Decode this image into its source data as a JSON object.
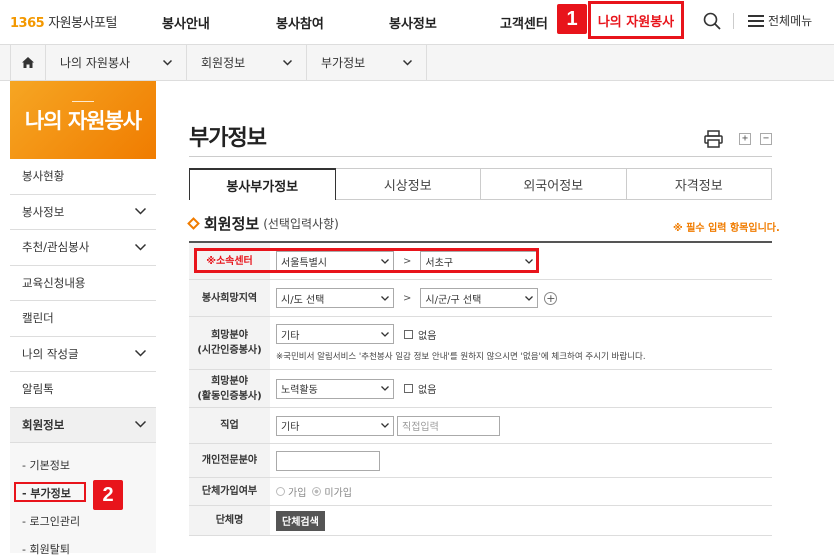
{
  "logo": {
    "num": "1365",
    "text": "자원봉사포털"
  },
  "nav": {
    "items": [
      "봉사안내",
      "봉사참여",
      "봉사정보",
      "고객센터"
    ],
    "active": "나의 자원봉사",
    "menu_label": "전체메뉴",
    "badge1": "1"
  },
  "breadcrumb": {
    "items": [
      "나의 자원봉사",
      "회원정보",
      "부가정보"
    ]
  },
  "sidebar": {
    "title": "나의 자원봉사",
    "items": [
      "봉사현황",
      "봉사정보",
      "추천/관심봉사",
      "교육신청내용",
      "캘린더",
      "나의 작성글",
      "알림톡",
      "회원정보"
    ],
    "sub_items": [
      "- 기본정보",
      "- 부가정보",
      "- 로그인관리",
      "- 회원탈퇴"
    ],
    "badge2": "2"
  },
  "main": {
    "page_title": "부가정보",
    "tabs": [
      "봉사부가정보",
      "시상정보",
      "외국어정보",
      "자격정보"
    ],
    "section_title": "회원정보",
    "section_sub": "(선택입력사항)",
    "required_note": "※ 필수 입력 항목입니다."
  },
  "form": {
    "center_label": "※소속센터",
    "center_sido": "서울특별시",
    "center_gu": "서초구",
    "gt": ">",
    "region_label": "봉사희망지역",
    "region_sido": "시/도 선택",
    "region_gu": "시/군/구 선택",
    "field1_label1": "희망분야",
    "field1_label2": "(시간인증봉사)",
    "field1_value": "기타",
    "none_label": "없음",
    "field1_note": "※국민비서 알림서비스 '추천봉사 일감 정보 안내'를 원하지 않으시면 '없음'에 체크하여 주시기 바랍니다.",
    "field2_label1": "희망분야",
    "field2_label2": "(활동인증봉사)",
    "field2_value": "노력활동",
    "job_label": "직업",
    "job_value": "기타",
    "job_placeholder": "직접입력",
    "expertise_label": "개인전문분야",
    "group_join_label": "단체가입여부",
    "group_join_yes": "가입",
    "group_join_no": "미가입",
    "group_name_label": "단체명",
    "group_search_btn": "단체검색"
  }
}
